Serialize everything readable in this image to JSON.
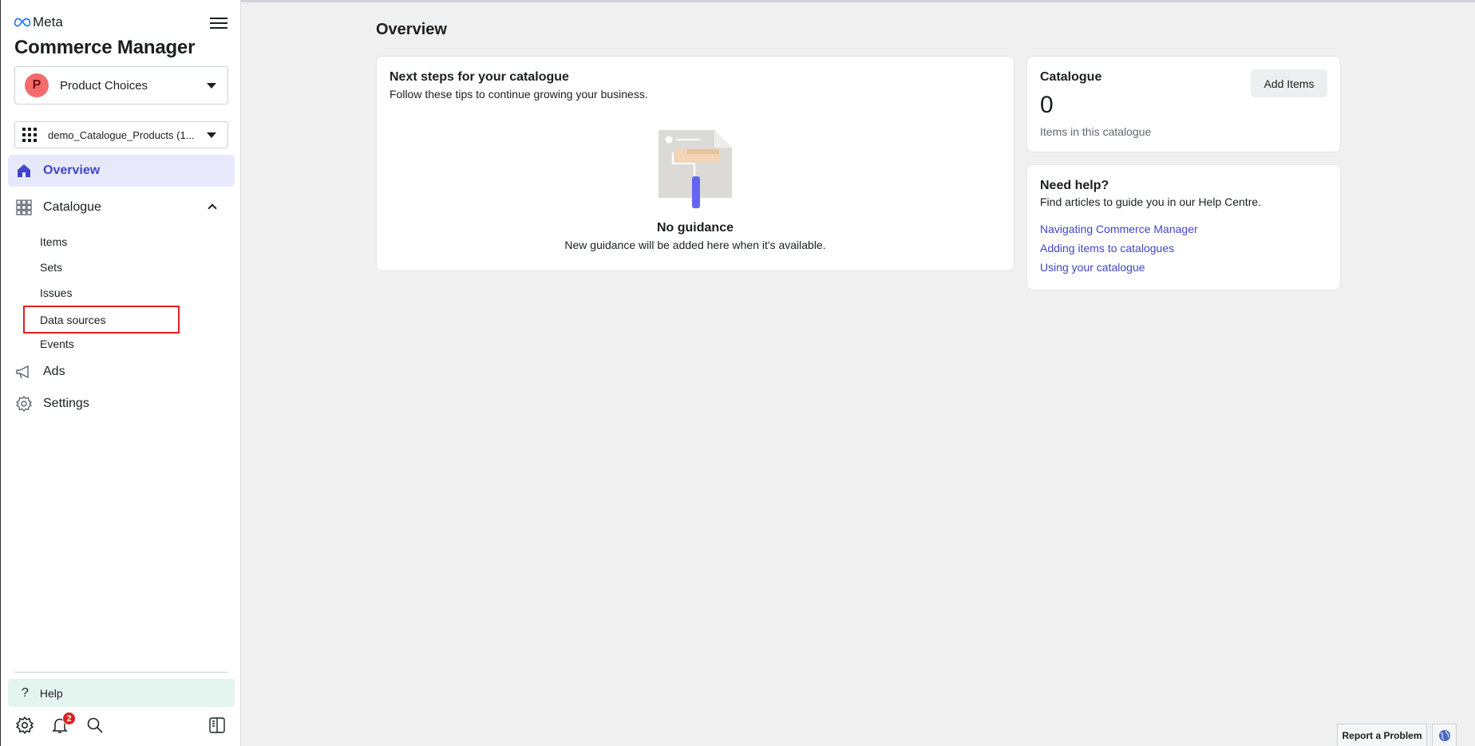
{
  "brand": {
    "logo_text": "Meta",
    "app_title": "Commerce Manager"
  },
  "business": {
    "avatar_letter": "P",
    "name": "Product Choices",
    "avatar_color": "#f56b6b"
  },
  "catalogue_selector": {
    "name": "demo_Catalogue_Products (1..."
  },
  "nav": {
    "overview": "Overview",
    "catalogue": "Catalogue",
    "sub_items": [
      "Items",
      "Sets",
      "Issues",
      "Data sources",
      "Events"
    ],
    "ads": "Ads",
    "settings": "Settings"
  },
  "sidebar_bottom": {
    "help": "Help",
    "notification_count": "2"
  },
  "main": {
    "title": "Overview",
    "next_steps": {
      "title": "Next steps for your catalogue",
      "subtitle": "Follow these tips to continue growing your business.",
      "empty_title": "No guidance",
      "empty_subtitle": "New guidance will be added here when it's available."
    },
    "catalogue_card": {
      "title": "Catalogue",
      "count": "0",
      "count_label": "Items in this catalogue",
      "add_button": "Add Items"
    },
    "help_card": {
      "title": "Need help?",
      "subtitle": "Find articles to guide you in our Help Centre.",
      "links": [
        "Navigating Commerce Manager",
        "Adding items to catalogues",
        "Using your catalogue"
      ]
    }
  },
  "footer": {
    "report": "Report a Problem"
  },
  "colors": {
    "accent": "#4145c8",
    "active_bg": "#e7e9fb",
    "help_bg": "#e4f4ef",
    "highlight": "#e41e1e"
  }
}
